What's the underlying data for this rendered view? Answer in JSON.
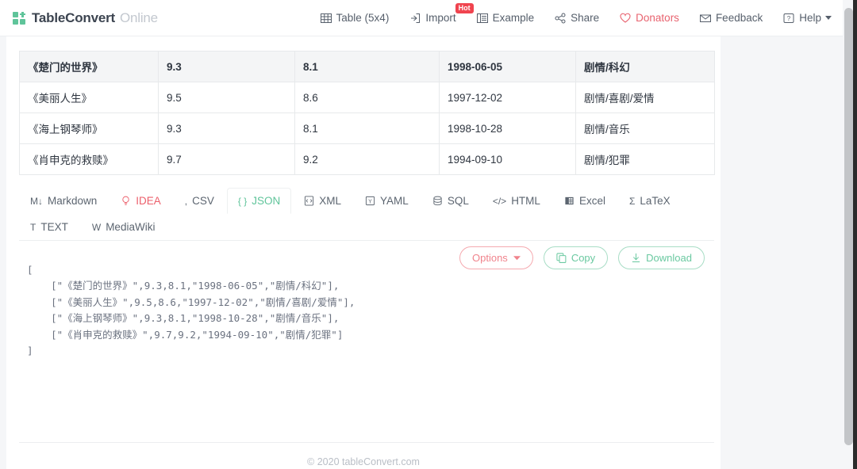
{
  "brand": {
    "name": "TableConvert",
    "suffix": "Online",
    "logo_icon": "grid-logo-icon"
  },
  "navbar": {
    "items": [
      {
        "label": "Table (5x4)",
        "icon": "table-icon",
        "badge": null,
        "style": "normal"
      },
      {
        "label": "Import",
        "icon": "import-icon",
        "badge": "Hot",
        "style": "normal"
      },
      {
        "label": "Example",
        "icon": "example-icon",
        "badge": null,
        "style": "normal"
      },
      {
        "label": "Share",
        "icon": "share-icon",
        "badge": null,
        "style": "normal"
      },
      {
        "label": "Donators",
        "icon": "heart-icon",
        "badge": null,
        "style": "red"
      },
      {
        "label": "Feedback",
        "icon": "envelope-icon",
        "badge": null,
        "style": "normal"
      },
      {
        "label": "Help",
        "icon": "help-icon",
        "badge": null,
        "style": "normal",
        "caret": true
      }
    ]
  },
  "table": {
    "headers": [
      "《楚门的世界》",
      "9.3",
      "8.1",
      "1998-06-05",
      "剧情/科幻"
    ],
    "rows": [
      [
        "《美丽人生》",
        "9.5",
        "8.6",
        "1997-12-02",
        "剧情/喜剧/爱情"
      ],
      [
        "《海上钢琴师》",
        "9.3",
        "8.1",
        "1998-10-28",
        "剧情/音乐"
      ],
      [
        "《肖申克的救赎》",
        "9.7",
        "9.2",
        "1994-09-10",
        "剧情/犯罪"
      ]
    ]
  },
  "format_tabs": {
    "active": "JSON",
    "items": [
      {
        "label": "Markdown",
        "icon": "markdown-icon",
        "glyph": "M↓",
        "style": "normal"
      },
      {
        "label": "IDEA",
        "icon": "lightbulb-icon",
        "glyph": " ",
        "style": "red"
      },
      {
        "label": "CSV",
        "icon": "comma-icon",
        "glyph": ",",
        "style": "normal"
      },
      {
        "label": "JSON",
        "icon": "braces-icon",
        "glyph": "{ }",
        "style": "active"
      },
      {
        "label": "XML",
        "icon": "xml-file-icon",
        "glyph": " ",
        "style": "normal"
      },
      {
        "label": "YAML",
        "icon": "yaml-icon",
        "glyph": " ",
        "style": "normal"
      },
      {
        "label": "SQL",
        "icon": "database-icon",
        "glyph": " ",
        "style": "normal"
      },
      {
        "label": "HTML",
        "icon": "code-brackets-icon",
        "glyph": "</>",
        "style": "normal"
      },
      {
        "label": "Excel",
        "icon": "excel-icon",
        "glyph": " ",
        "style": "normal"
      },
      {
        "label": "LaTeX",
        "icon": "sigma-icon",
        "glyph": "Σ",
        "style": "normal"
      },
      {
        "label": "TEXT",
        "icon": "text-icon",
        "glyph": "T",
        "style": "normal"
      },
      {
        "label": "MediaWiki",
        "icon": "wiki-icon",
        "glyph": "W",
        "style": "normal"
      }
    ]
  },
  "output": {
    "code": "[\n    [\"《楚门的世界》\",9.3,8.1,\"1998-06-05\",\"剧情/科幻\"],\n    [\"《美丽人生》\",9.5,8.6,\"1997-12-02\",\"剧情/喜剧/爱情\"],\n    [\"《海上钢琴师》\",9.3,8.1,\"1998-10-28\",\"剧情/音乐\"],\n    [\"《肖申克的救赎》\",9.7,9.2,\"1994-09-10\",\"剧情/犯罪\"]\n]",
    "buttons": [
      {
        "label": "Options",
        "icon": "chevron-down-icon",
        "style": "options"
      },
      {
        "label": "Copy",
        "icon": "copy-icon",
        "style": "green"
      },
      {
        "label": "Download",
        "icon": "download-icon",
        "style": "green"
      }
    ]
  },
  "footer": {
    "text": "© 2020 tableConvert.com"
  },
  "colors": {
    "accent_green": "#5fc49a",
    "accent_red": "#ec5f6b",
    "hot_badge": "#f0444f",
    "text": "#3c4450"
  }
}
